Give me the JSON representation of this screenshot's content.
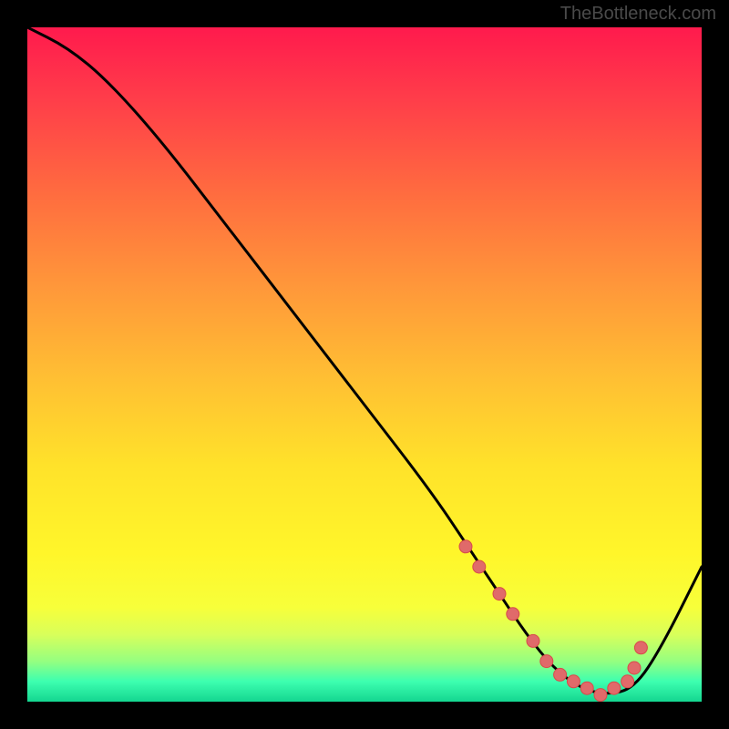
{
  "attribution": "TheBottleneck.com",
  "chart_data": {
    "type": "line",
    "title": "",
    "xlabel": "",
    "ylabel": "",
    "xlim": [
      0,
      100
    ],
    "ylim": [
      0,
      100
    ],
    "background_gradient": {
      "direction": "vertical",
      "stops": [
        {
          "pos": 0,
          "color": "#ff1a4d"
        },
        {
          "pos": 50,
          "color": "#ffe22a"
        },
        {
          "pos": 95,
          "color": "#3dffb0"
        },
        {
          "pos": 100,
          "color": "#14d690"
        }
      ]
    },
    "series": [
      {
        "name": "bottleneck-curve",
        "x": [
          0,
          6,
          12,
          20,
          30,
          40,
          50,
          60,
          66,
          70,
          74,
          78,
          82,
          86,
          90,
          94,
          100
        ],
        "y": [
          100,
          97,
          92,
          83,
          70,
          57,
          44,
          31,
          22,
          16,
          10,
          5,
          2,
          1,
          2,
          8,
          20
        ]
      }
    ],
    "markers": {
      "name": "highlight-dots",
      "x": [
        65,
        67,
        70,
        72,
        75,
        77,
        79,
        81,
        83,
        85,
        87,
        89,
        90,
        91
      ],
      "y": [
        23,
        20,
        16,
        13,
        9,
        6,
        4,
        3,
        2,
        1,
        2,
        3,
        5,
        8
      ]
    }
  }
}
